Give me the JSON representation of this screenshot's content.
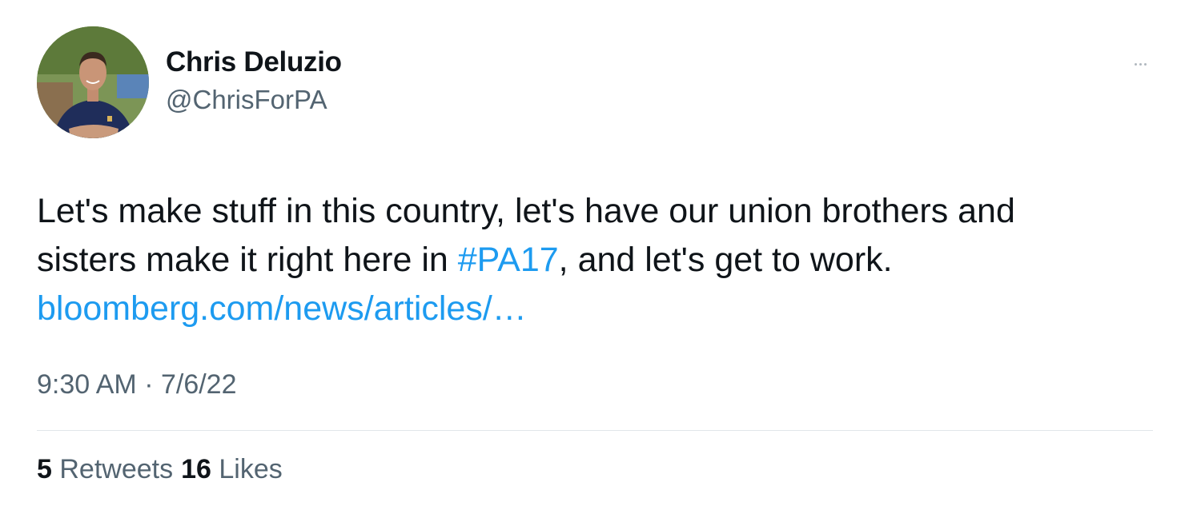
{
  "author": {
    "display_name": "Chris Deluzio",
    "handle": "@ChrisForPA"
  },
  "more_icon": "more-horizontal-icon",
  "tweet": {
    "line1": "Let's make stuff in this country, let's have our union brothers and",
    "line2_before": "sisters make it right here in ",
    "hashtag": "#PA17",
    "line2_after": ", and let's get to work.",
    "link_text": "bloomberg.com/news/articles/…"
  },
  "timestamp": {
    "time": "9:30 AM",
    "separator": " · ",
    "date": "7/6/22"
  },
  "stats": {
    "retweets_count": "5",
    "retweets_label": "Retweets",
    "likes_count": "16",
    "likes_label": "Likes"
  },
  "colors": {
    "link": "#1d9bf0",
    "secondary_text": "#536471",
    "primary_text": "#0f1419",
    "divider": "#e1e6ea"
  }
}
